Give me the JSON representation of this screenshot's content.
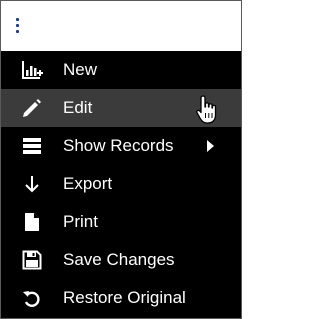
{
  "menu": {
    "items": [
      {
        "label": "New",
        "icon": "new-chart-icon"
      },
      {
        "label": "Edit",
        "icon": "pencil-icon"
      },
      {
        "label": "Show Records",
        "icon": "list-icon",
        "has_submenu": true
      },
      {
        "label": "Export",
        "icon": "arrow-down-icon"
      },
      {
        "label": "Print",
        "icon": "document-icon"
      },
      {
        "label": "Save Changes",
        "icon": "save-icon"
      },
      {
        "label": "Restore Original",
        "icon": "restore-icon"
      }
    ]
  },
  "colors": {
    "menu_background": "#000000",
    "hover_background": "#3b3b3b",
    "menu_text": "#ffffff",
    "kebab_accent": "#1e3a9a",
    "topbar_background": "#ffffff"
  }
}
